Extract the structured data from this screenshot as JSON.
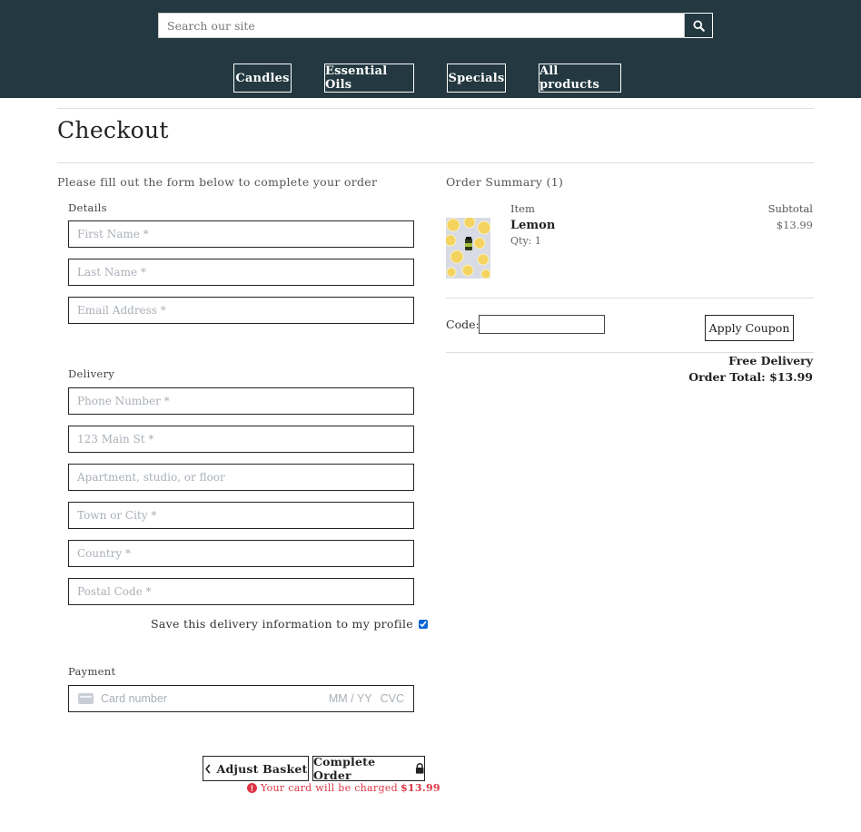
{
  "colors": {
    "header_bg": "#233840",
    "accent_check": "#0a66d6",
    "error": "#dc3545"
  },
  "header": {
    "search_placeholder": "Search our site",
    "search_icon": "search-icon",
    "nav": [
      {
        "label": "Candles"
      },
      {
        "label": "Essential Oils"
      },
      {
        "label": "Specials"
      },
      {
        "label": "All products"
      }
    ]
  },
  "page": {
    "title": "Checkout",
    "intro": "Please fill out the form below to complete your order"
  },
  "form": {
    "details_label": "Details",
    "details_fields": [
      {
        "placeholder": "First Name *"
      },
      {
        "placeholder": "Last Name *"
      },
      {
        "placeholder": "Email Address *"
      }
    ],
    "delivery_label": "Delivery",
    "delivery_fields": [
      {
        "placeholder": "Phone Number *"
      },
      {
        "placeholder": "123 Main St *"
      },
      {
        "placeholder": "Apartment, studio, or floor"
      },
      {
        "placeholder": "Town or City *"
      },
      {
        "placeholder": "Country *"
      },
      {
        "placeholder": "Postal Code *"
      }
    ],
    "save_delivery_label": "Save this delivery information to my profile",
    "save_delivery_checked": true,
    "payment_label": "Payment",
    "card": {
      "number_placeholder": "Card number",
      "expiry_placeholder": "MM / YY",
      "cvc_placeholder": "CVC"
    },
    "adjust_basket_label": "Adjust Basket",
    "complete_order_label": "Complete Order",
    "charge_note": "Your card will be charged",
    "charge_amount": "$13.99"
  },
  "summary": {
    "title": "Order Summary (1)",
    "col_item": "Item",
    "col_subtotal": "Subtotal",
    "items": [
      {
        "name": "Lemon",
        "qty": "Qty: 1",
        "subtotal": "$13.99"
      }
    ],
    "code_label": "Code:",
    "apply_coupon_label": "Apply Coupon",
    "delivery": "Free Delivery",
    "order_total": "Order Total: $13.99"
  }
}
